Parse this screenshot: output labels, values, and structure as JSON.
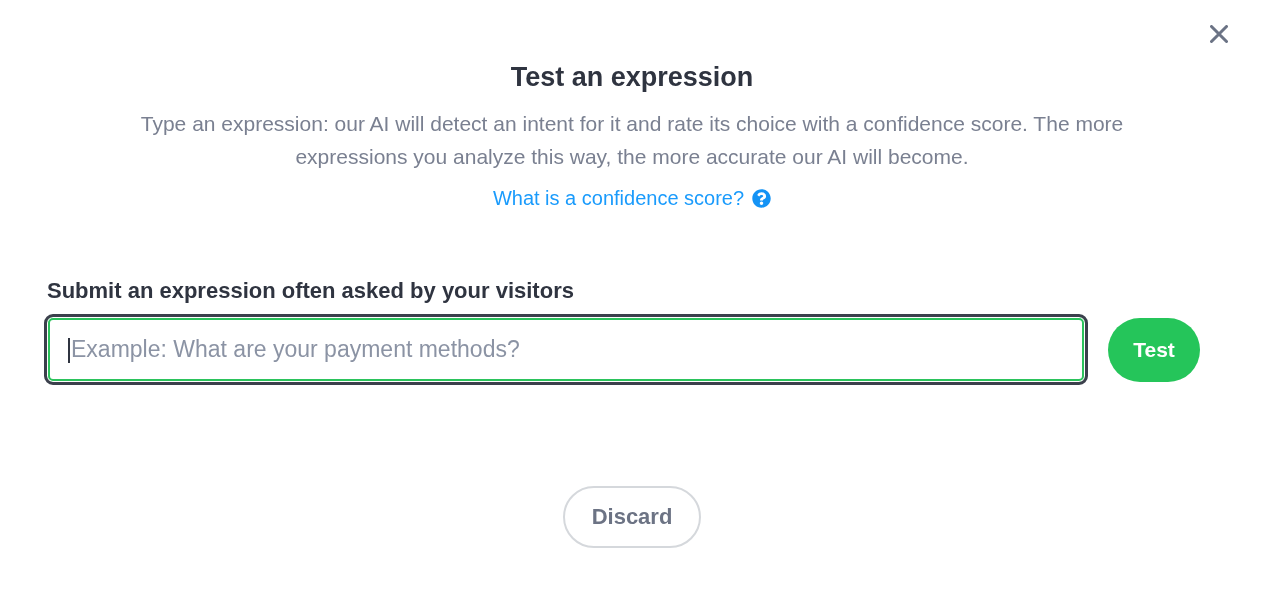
{
  "dialog": {
    "title": "Test an expression",
    "description": "Type an expression: our AI will detect an intent for it and rate its choice with a confidence score. The more expressions you analyze this way, the more accurate our AI will become.",
    "help_link": "What is a confidence score?"
  },
  "form": {
    "label": "Submit an expression often asked by your visitors",
    "input": {
      "placeholder": "Example: What are your payment methods?",
      "focused": true
    },
    "submit_button": "Test"
  },
  "footer": {
    "discard_button": "Discard"
  }
}
